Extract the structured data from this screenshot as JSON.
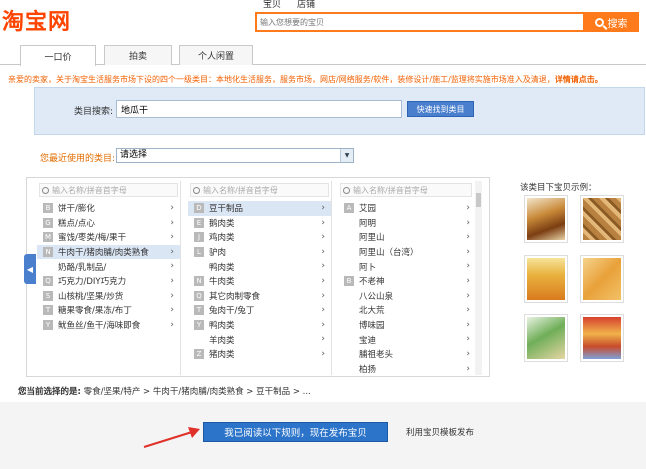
{
  "header": {
    "logo_text": "淘宝网",
    "search_tabs": [
      "宝贝",
      "店铺"
    ],
    "search_placeholder": "输入您想要的宝贝",
    "search_button": "搜索"
  },
  "type_tabs": [
    "一口价",
    "拍卖",
    "个人闲置"
  ],
  "notice": {
    "text": "亲爱的卖家，关于淘宝生活服务市场下设的四个一级类目：本地化生活服务，服务市场，网店/网络服务/软件，装修设计/施工/监理将实施市场准入及清退，",
    "link": "详情请点击。"
  },
  "category_search": {
    "label": "类目搜索:",
    "value": "地瓜干",
    "button": "快速找到类目"
  },
  "recent": {
    "label": "您最近使用的类目:",
    "value": "请选择"
  },
  "column_search_placeholder": "输入名称/拼音首字母",
  "columns": [
    {
      "items": [
        {
          "letter": "B",
          "label": "饼干/膨化"
        },
        {
          "letter": "G",
          "label": "糕点/点心"
        },
        {
          "letter": "M",
          "label": "蜜饯/枣类/梅/果干"
        },
        {
          "letter": "N",
          "label": "牛肉干/猪肉脯/肉类熟食",
          "selected": true
        },
        {
          "letter": "",
          "label": "奶酪/乳制品/"
        },
        {
          "letter": "Q",
          "label": "巧克力/DIY巧克力"
        },
        {
          "letter": "S",
          "label": "山核桃/坚果/炒货"
        },
        {
          "letter": "T",
          "label": "糖果零食/果冻/布丁"
        },
        {
          "letter": "Y",
          "label": "鱿鱼丝/鱼干/海味即食"
        }
      ]
    },
    {
      "items": [
        {
          "letter": "D",
          "label": "豆干制品",
          "selected": true
        },
        {
          "letter": "E",
          "label": "鹅肉类"
        },
        {
          "letter": "J",
          "label": "鸡肉类"
        },
        {
          "letter": "L",
          "label": "驴肉"
        },
        {
          "letter": "",
          "label": "鸭肉类"
        },
        {
          "letter": "N",
          "label": "牛肉类"
        },
        {
          "letter": "Q",
          "label": "其它肉制零食"
        },
        {
          "letter": "T",
          "label": "兔肉干/兔丁"
        },
        {
          "letter": "Y",
          "label": "鸭肉类"
        },
        {
          "letter": "",
          "label": "羊肉类"
        },
        {
          "letter": "Z",
          "label": "猪肉类"
        }
      ]
    },
    {
      "items": [
        {
          "letter": "A",
          "label": "艾园"
        },
        {
          "letter": "",
          "label": "阿明"
        },
        {
          "letter": "",
          "label": "阿里山"
        },
        {
          "letter": "",
          "label": "阿里山（台湾）"
        },
        {
          "letter": "",
          "label": "阿卜"
        },
        {
          "letter": "B",
          "label": "不老神"
        },
        {
          "letter": "",
          "label": "八公山泉"
        },
        {
          "letter": "",
          "label": "北大荒"
        },
        {
          "letter": "",
          "label": "博味园"
        },
        {
          "letter": "",
          "label": "宝迪"
        },
        {
          "letter": "",
          "label": "脯祖老头"
        },
        {
          "letter": "",
          "label": "柏扬"
        }
      ]
    }
  ],
  "examples_label": "该类目下宝贝示例：",
  "current_path": {
    "label": "您当前选择的是:",
    "value": "零食/坚果/特产 > 牛肉干/猪肉脯/肉类熟食 > 豆干制品 > ..."
  },
  "publish_button": "我已阅读以下规则，现在发布宝贝",
  "template_link": "利用宝贝模板发布",
  "colors": {
    "accent_orange": "#ff7a1a",
    "brand_blue": "#2c74c9",
    "notice_orange": "#f25f00",
    "arrow_red": "#e0302a"
  }
}
